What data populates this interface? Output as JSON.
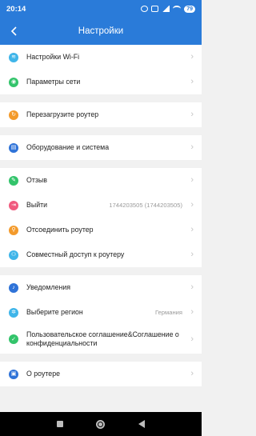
{
  "status_bar": {
    "time": "20:14",
    "battery": "79"
  },
  "header": {
    "title": "Настройки",
    "back_icon": "chevron-left-icon"
  },
  "groups": [
    {
      "items": [
        {
          "label": "Настройки Wi-Fi",
          "icon": "wifi-icon",
          "color": "#3fb5e9"
        },
        {
          "label": "Параметры сети",
          "icon": "network-icon",
          "color": "#33c46b"
        }
      ]
    },
    {
      "items": [
        {
          "label": "Перезагрузите роутер",
          "icon": "restart-icon",
          "color": "#f39a2b"
        }
      ]
    },
    {
      "items": [
        {
          "label": "Оборудование и система",
          "icon": "device-icon",
          "color": "#2f73d8"
        }
      ]
    },
    {
      "items": [
        {
          "label": "Отзыв",
          "icon": "feedback-icon",
          "color": "#33c46b"
        },
        {
          "label": "Выйти",
          "icon": "logout-icon",
          "color": "#f05a7e",
          "value": "1744203505 (1744203505)"
        },
        {
          "label": "Отсоединить роутер",
          "icon": "unlink-icon",
          "color": "#f39a2b"
        },
        {
          "label": "Совместный доступ к роутеру",
          "icon": "share-icon",
          "color": "#3fb5e9"
        }
      ]
    },
    {
      "items": [
        {
          "label": "Уведомления",
          "icon": "bell-icon",
          "color": "#2f73d8"
        },
        {
          "label": "Выберите регион",
          "icon": "region-icon",
          "color": "#3fb5e9",
          "value": "Германия"
        },
        {
          "label": "Пользовательское соглашение&Соглашение о конфиденциальности",
          "icon": "agreement-icon",
          "color": "#33c46b"
        }
      ]
    },
    {
      "items": [
        {
          "label": "О роутере",
          "icon": "info-icon",
          "color": "#2f73d8"
        }
      ]
    }
  ]
}
